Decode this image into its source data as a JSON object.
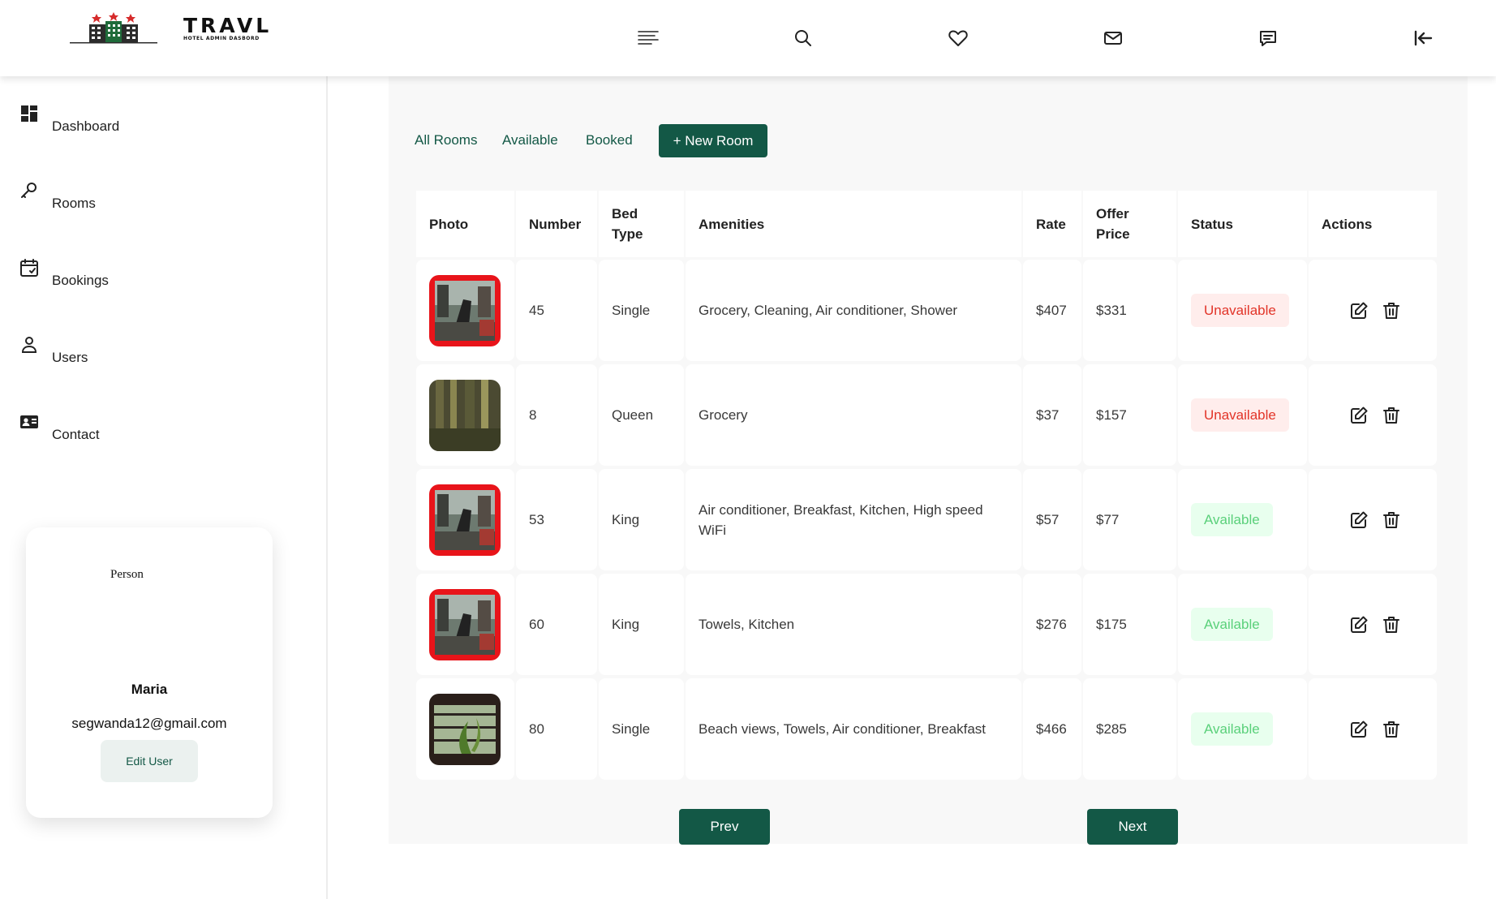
{
  "header": {
    "logo_title": "TRAVL",
    "logo_subtitle": "HOTEL ADMIN DASBORD",
    "icons": [
      "menu-icon",
      "search-icon",
      "heart-icon",
      "mail-icon",
      "message-icon",
      "collapse-icon"
    ]
  },
  "sidebar": {
    "items": [
      {
        "label": "Dashboard",
        "icon": "dashboard-icon"
      },
      {
        "label": "Rooms",
        "icon": "key-icon"
      },
      {
        "label": "Bookings",
        "icon": "calendar-icon"
      },
      {
        "label": "Users",
        "icon": "user-icon"
      },
      {
        "label": "Contact",
        "icon": "contact-card-icon"
      }
    ],
    "user_card": {
      "avatar_alt": "Person",
      "name": "Maria",
      "email": "segwanda12@gmail.com",
      "edit_label": "Edit User"
    }
  },
  "tabs": {
    "all": "All Rooms",
    "available": "Available",
    "booked": "Booked",
    "new_room": "+ New Room"
  },
  "table": {
    "headers": {
      "photo": "Photo",
      "number": "Number",
      "bed_type": "Bed Type",
      "amenities": "Amenities",
      "rate": "Rate",
      "offer_price": "Offer Price",
      "status": "Status",
      "actions": "Actions"
    },
    "rows": [
      {
        "photo": "street",
        "number": "45",
        "bed_type": "Single",
        "amenities": "Grocery, Cleaning, Air conditioner, Shower",
        "rate": "$407",
        "offer_price": "$331",
        "status": "Unavailable"
      },
      {
        "photo": "forest",
        "number": "8",
        "bed_type": "Queen",
        "amenities": "Grocery",
        "rate": "$37",
        "offer_price": "$157",
        "status": "Unavailable"
      },
      {
        "photo": "street",
        "number": "53",
        "bed_type": "King",
        "amenities": "Air conditioner, Breakfast, Kitchen, High speed WiFi",
        "rate": "$57",
        "offer_price": "$77",
        "status": "Available"
      },
      {
        "photo": "street",
        "number": "60",
        "bed_type": "King",
        "amenities": "Towels, Kitchen",
        "rate": "$276",
        "offer_price": "$175",
        "status": "Available"
      },
      {
        "photo": "plant",
        "number": "80",
        "bed_type": "Single",
        "amenities": "Beach views, Towels, Air conditioner, Breakfast",
        "rate": "$466",
        "offer_price": "$285",
        "status": "Available"
      }
    ]
  },
  "pagination": {
    "prev": "Prev",
    "next": "Next"
  },
  "colors": {
    "brand_green": "#135846",
    "unavailable_text": "#e23428",
    "unavailable_bg": "#ffedec",
    "available_text": "#5ad07a",
    "available_bg": "#e8ffee"
  }
}
